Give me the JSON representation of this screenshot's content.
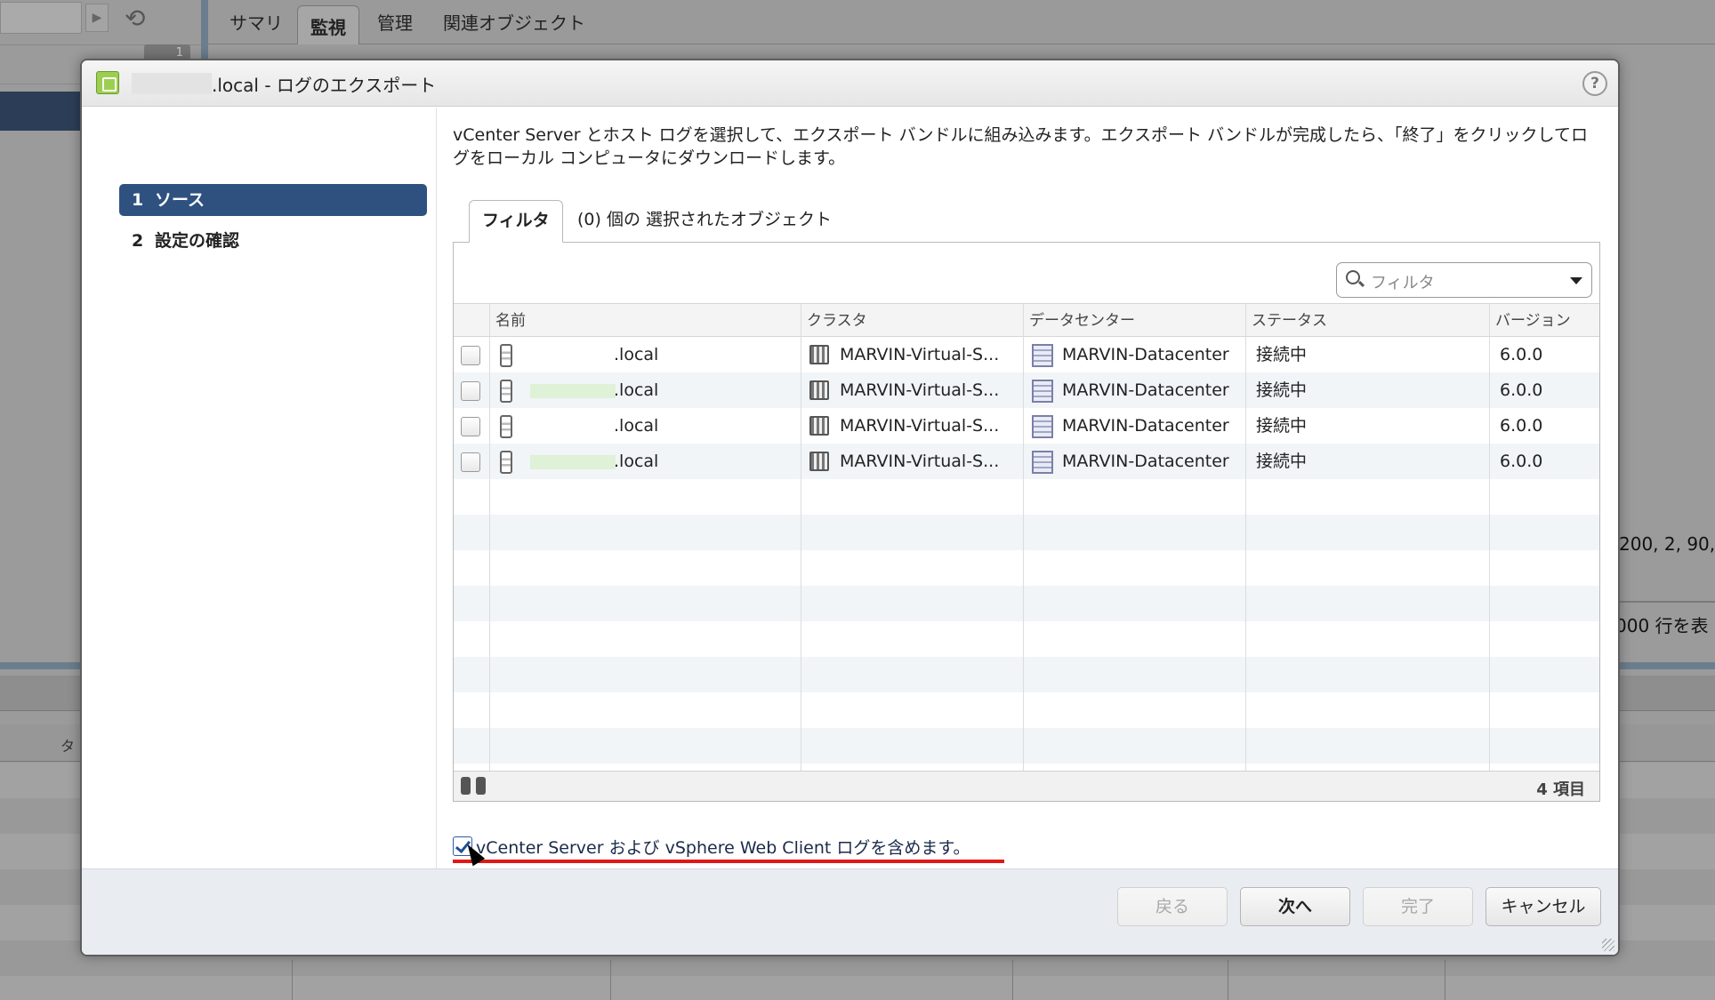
{
  "background": {
    "tabs": [
      "サマリ",
      "監視",
      "管理",
      "関連オブジェクト"
    ],
    "badge": "1",
    "right_text_1": "200, 2, 90, 2",
    "right_text_2": "000 行を表",
    "bottom_column": "タ"
  },
  "dialog": {
    "title": ".local - ログのエクスポート",
    "help": "?",
    "nav": [
      {
        "num": "1",
        "label": "ソース"
      },
      {
        "num": "2",
        "label": "設定の確認"
      }
    ],
    "instructions": "vCenter Server とホスト ログを選択して、エクスポート バンドルに組み込みます。エクスポート バンドルが完成したら、「終了」をクリックしてログをローカル コンピュータにダウンロードします。",
    "tabs": {
      "filter": "フィルタ",
      "selected": "(0) 個の 選択されたオブジェクト"
    },
    "filter_placeholder": "フィルタ",
    "columns": [
      "名前",
      "クラスタ",
      "データセンター",
      "ステータス",
      "バージョン"
    ],
    "rows": [
      {
        "name": ".local",
        "cluster": "MARVIN-Virtual-S...",
        "datacenter": "MARVIN-Datacenter",
        "status": "接続中",
        "version": "6.0.0"
      },
      {
        "name": ".local",
        "cluster": "MARVIN-Virtual-S...",
        "datacenter": "MARVIN-Datacenter",
        "status": "接続中",
        "version": "6.0.0"
      },
      {
        "name": ".local",
        "cluster": "MARVIN-Virtual-S...",
        "datacenter": "MARVIN-Datacenter",
        "status": "接続中",
        "version": "6.0.0"
      },
      {
        "name": ".local",
        "cluster": "MARVIN-Virtual-S...",
        "datacenter": "MARVIN-Datacenter",
        "status": "接続中",
        "version": "6.0.0"
      }
    ],
    "item_count": "4 項目",
    "include_label": "vCenter Server および vSphere Web Client ログを含めます。",
    "include_checked": true,
    "buttons": {
      "back": "戻る",
      "next": "次へ",
      "finish": "完了",
      "cancel": "キャンセル"
    },
    "accent_color": "#2e5180",
    "highlight_color": "#e01818"
  }
}
